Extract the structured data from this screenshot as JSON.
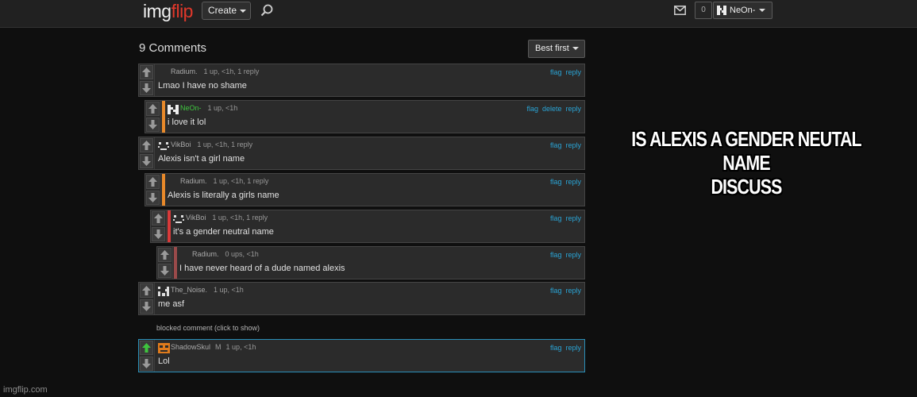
{
  "header": {
    "logo_main": "img",
    "logo_accent": "flip",
    "create_label": "Create",
    "notification_count": "0",
    "username": "NeOn-",
    "icons": [
      "search-icon",
      "mail-icon",
      "user-avatar-icon"
    ]
  },
  "comments_section": {
    "title": "9 Comments",
    "sort_label": "Best first",
    "blocked_text": "blocked comment (click to show)",
    "comments": [
      {
        "username": "Radium.",
        "stats": "1 up, <1h, 1 reply",
        "text": "Lmao I have no shame",
        "actions": [
          "flag",
          "reply"
        ]
      },
      {
        "username": "NeOn-",
        "stats": "1 up, <1h",
        "text": "i love it lol",
        "actions": [
          "flag",
          "delete",
          "reply"
        ]
      },
      {
        "username": "VikBoi",
        "stats": "1 up, <1h, 1 reply",
        "text": "Alexis isn't a girl name",
        "actions": [
          "flag",
          "reply"
        ]
      },
      {
        "username": "Radium.",
        "stats": "1 up, <1h, 1 reply",
        "text": "Alexis is literally a girls name",
        "actions": [
          "flag",
          "reply"
        ]
      },
      {
        "username": "VikBoi",
        "stats": "1 up, <1h, 1 reply",
        "text": "it's a gender neutral name",
        "actions": [
          "flag",
          "reply"
        ]
      },
      {
        "username": "Radium.",
        "stats": "0 ups, <1h",
        "text": "I have never heard of a dude named alexis",
        "actions": [
          "flag",
          "reply"
        ]
      },
      {
        "username": "The_Noise.",
        "stats": "1 up, <1h",
        "text": "me asf",
        "actions": [
          "flag",
          "reply"
        ]
      },
      {
        "username": "ShadowSkul",
        "badge": "M",
        "stats": "1 up, <1h",
        "text": "Lol",
        "actions": [
          "flag",
          "reply"
        ]
      }
    ]
  },
  "meme": {
    "line1": "IS ALEXIS A GENDER NEUTAL NAME",
    "line2": "DISCUSS"
  },
  "watermark": "imgflip.com",
  "colors": {
    "depth_orange": "#e8892a",
    "depth_red": "#d83a3a",
    "depth_dark_red": "#9a4a4a",
    "link_blue": "#2aa4d5",
    "self_green": "#3fc53f",
    "upvoted_green": "#3ec43e",
    "logo_red": "#e0382b"
  }
}
